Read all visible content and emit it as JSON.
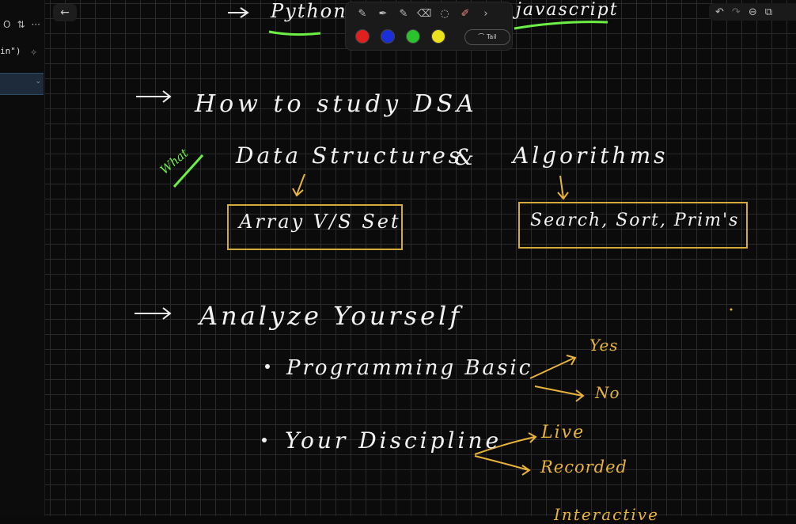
{
  "left_panel": {
    "icon_a": "O",
    "icon_b": "⇅",
    "more": "···",
    "code_line": "in\")"
  },
  "toolbar": {
    "back": "←",
    "chevron": "›",
    "tail_label": "Tail",
    "colors": [
      "#e21f1f",
      "#1b2fd8",
      "#2bc32b",
      "#ece21b"
    ]
  },
  "right_toolbar": {
    "undo": "↶",
    "redo": "↷",
    "zoom_out": "⊖",
    "copy": "⧉"
  },
  "notes": {
    "line1_left": "Python",
    "line1_right": "javascript",
    "h1": "How to study DSA",
    "what": "What",
    "ds": "Data Structures",
    "amp": "&",
    "algo": "Algorithms",
    "box1": "Array V/S Set",
    "box2": "Search, Sort, Prim's",
    "h2": "Analyze Yourself",
    "b1": "Programming Basic",
    "yes": "Yes",
    "no": "No",
    "b2": "Your Discipline",
    "live": "Live",
    "recorded": "Recorded",
    "cut": "Interactive"
  }
}
